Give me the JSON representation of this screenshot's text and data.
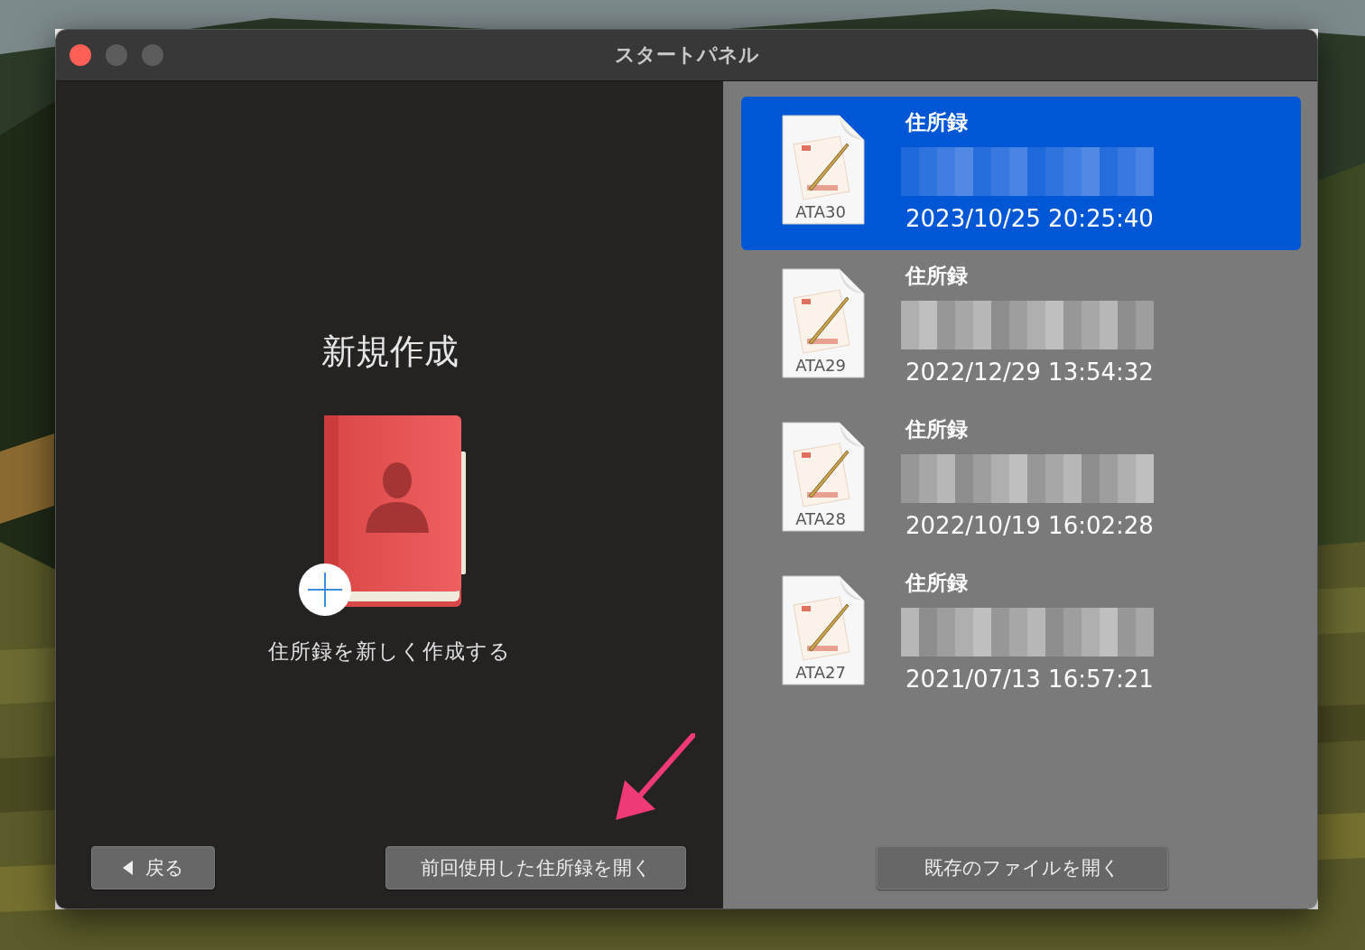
{
  "window": {
    "title": "スタートパネル"
  },
  "new_document": {
    "heading": "新規作成",
    "caption": "住所録を新しく作成する"
  },
  "left_buttons": [
    {
      "kind": "back",
      "label": "戻る"
    },
    {
      "kind": "plain",
      "label": "前回使用した住所録を開く"
    }
  ],
  "recent_files": [
    {
      "badge": "ATA30",
      "title": "住所録",
      "date": "2023/10/25 20:25:40",
      "selected": true
    },
    {
      "badge": "ATA29",
      "title": "住所録",
      "date": "2022/12/29 13:54:32",
      "selected": false
    },
    {
      "badge": "ATA28",
      "title": "住所録",
      "date": "2022/10/19 16:02:28",
      "selected": false
    },
    {
      "badge": "ATA27",
      "title": "住所録",
      "date": "2021/07/13 16:57:21",
      "selected": false
    }
  ],
  "right_button": {
    "label": "既存のファイルを開く"
  }
}
